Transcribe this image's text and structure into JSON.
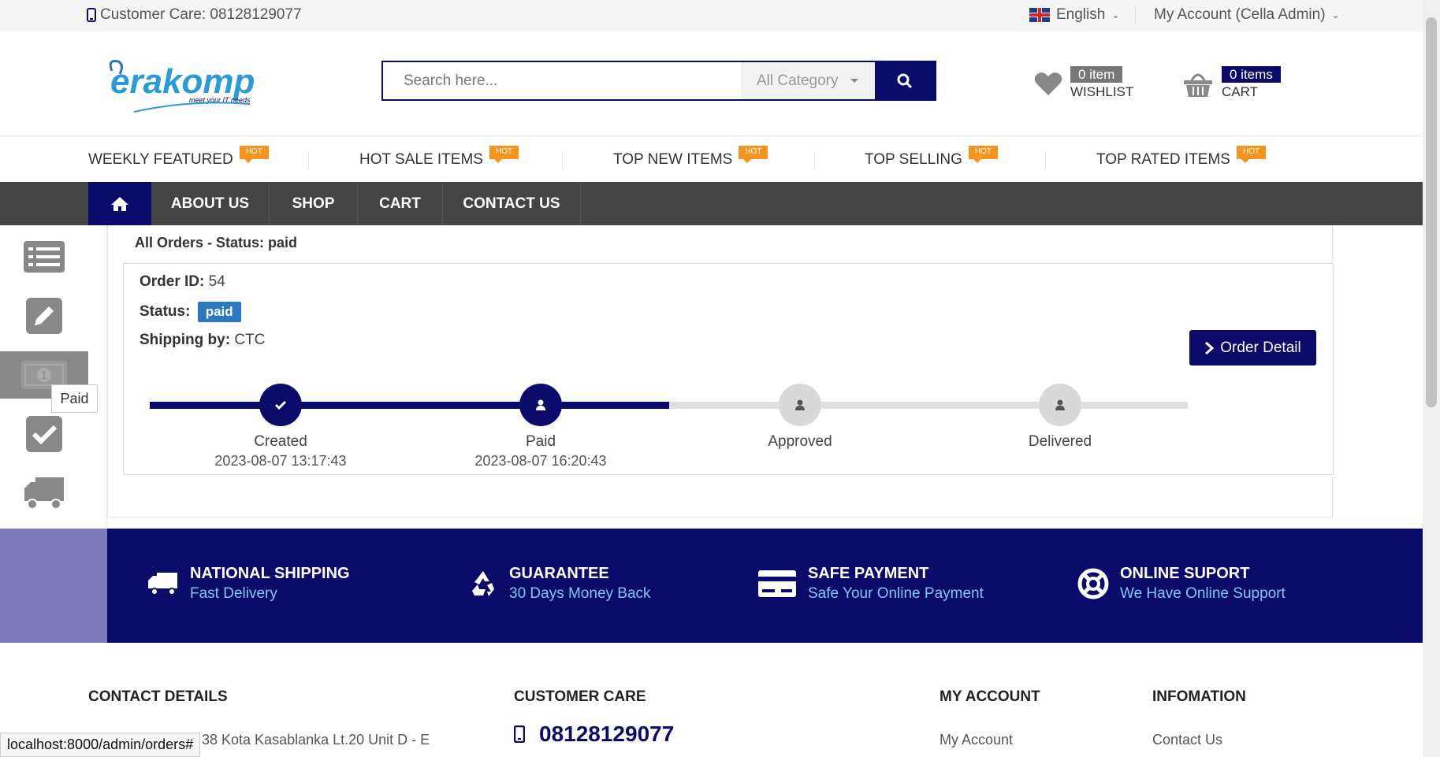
{
  "topbar": {
    "customer_care": "Customer Care: 08128129077",
    "language": "English",
    "account": "My Account (Cella Admin)"
  },
  "header": {
    "search_placeholder": "Search here...",
    "category": "All Category",
    "wishlist_count": "0 item",
    "wishlist_label": "WISHLIST",
    "cart_count": "0 items",
    "cart_label": "CART"
  },
  "featured_nav": [
    {
      "label": "WEEKLY FEATURED",
      "badge": "HOT"
    },
    {
      "label": "HOT SALE ITEMS",
      "badge": "HOT"
    },
    {
      "label": "TOP NEW ITEMS",
      "badge": "HOT"
    },
    {
      "label": "TOP SELLING",
      "badge": "HOT"
    },
    {
      "label": "TOP RATED ITEMS",
      "badge": "HOT"
    }
  ],
  "main_nav": [
    "ABOUT US",
    "SHOP",
    "CART",
    "CONTACT US"
  ],
  "sidebar": {
    "tooltip": "Paid",
    "icons": [
      "list-icon",
      "edit-icon",
      "money-icon",
      "check-icon",
      "truck-icon"
    ]
  },
  "orders": {
    "title": "All Orders - Status: paid",
    "order_id_label": "Order ID:",
    "order_id": "54",
    "status_label": "Status:",
    "status": "paid",
    "shipping_label": "Shipping by:",
    "shipping": "CTC",
    "detail_button": "Order Detail",
    "progress": 0.5,
    "steps": [
      {
        "label": "Created",
        "date": "2023-08-07 13:17:43"
      },
      {
        "label": "Paid",
        "date": "2023-08-07 16:20:43"
      },
      {
        "label": "Approved",
        "date": ""
      },
      {
        "label": "Delivered",
        "date": ""
      }
    ]
  },
  "services": [
    {
      "title": "NATIONAL SHIPPING",
      "subtitle": "Fast Delivery"
    },
    {
      "title": "GUARANTEE",
      "subtitle": "30 Days Money Back"
    },
    {
      "title": "SAFE PAYMENT",
      "subtitle": "Safe Your Online Payment"
    },
    {
      "title": "ONLINE SUPORT",
      "subtitle": "We Have Online Support"
    }
  ],
  "footer": {
    "contact_title": "CONTACT DETAILS",
    "contact_address": "38 Kota Kasablanka Lt.20 Unit D - E",
    "care_title": "CUSTOMER CARE",
    "care_phone": "08128129077",
    "account_title": "MY ACCOUNT",
    "account_link": "My Account",
    "info_title": "INFOMATION",
    "info_link": "Contact Us"
  },
  "status_url": "localhost:8000/admin/orders#",
  "colors": {
    "navy": "#0a0a6b",
    "hot": "#f7941d",
    "badge_blue": "#2a78c2"
  }
}
